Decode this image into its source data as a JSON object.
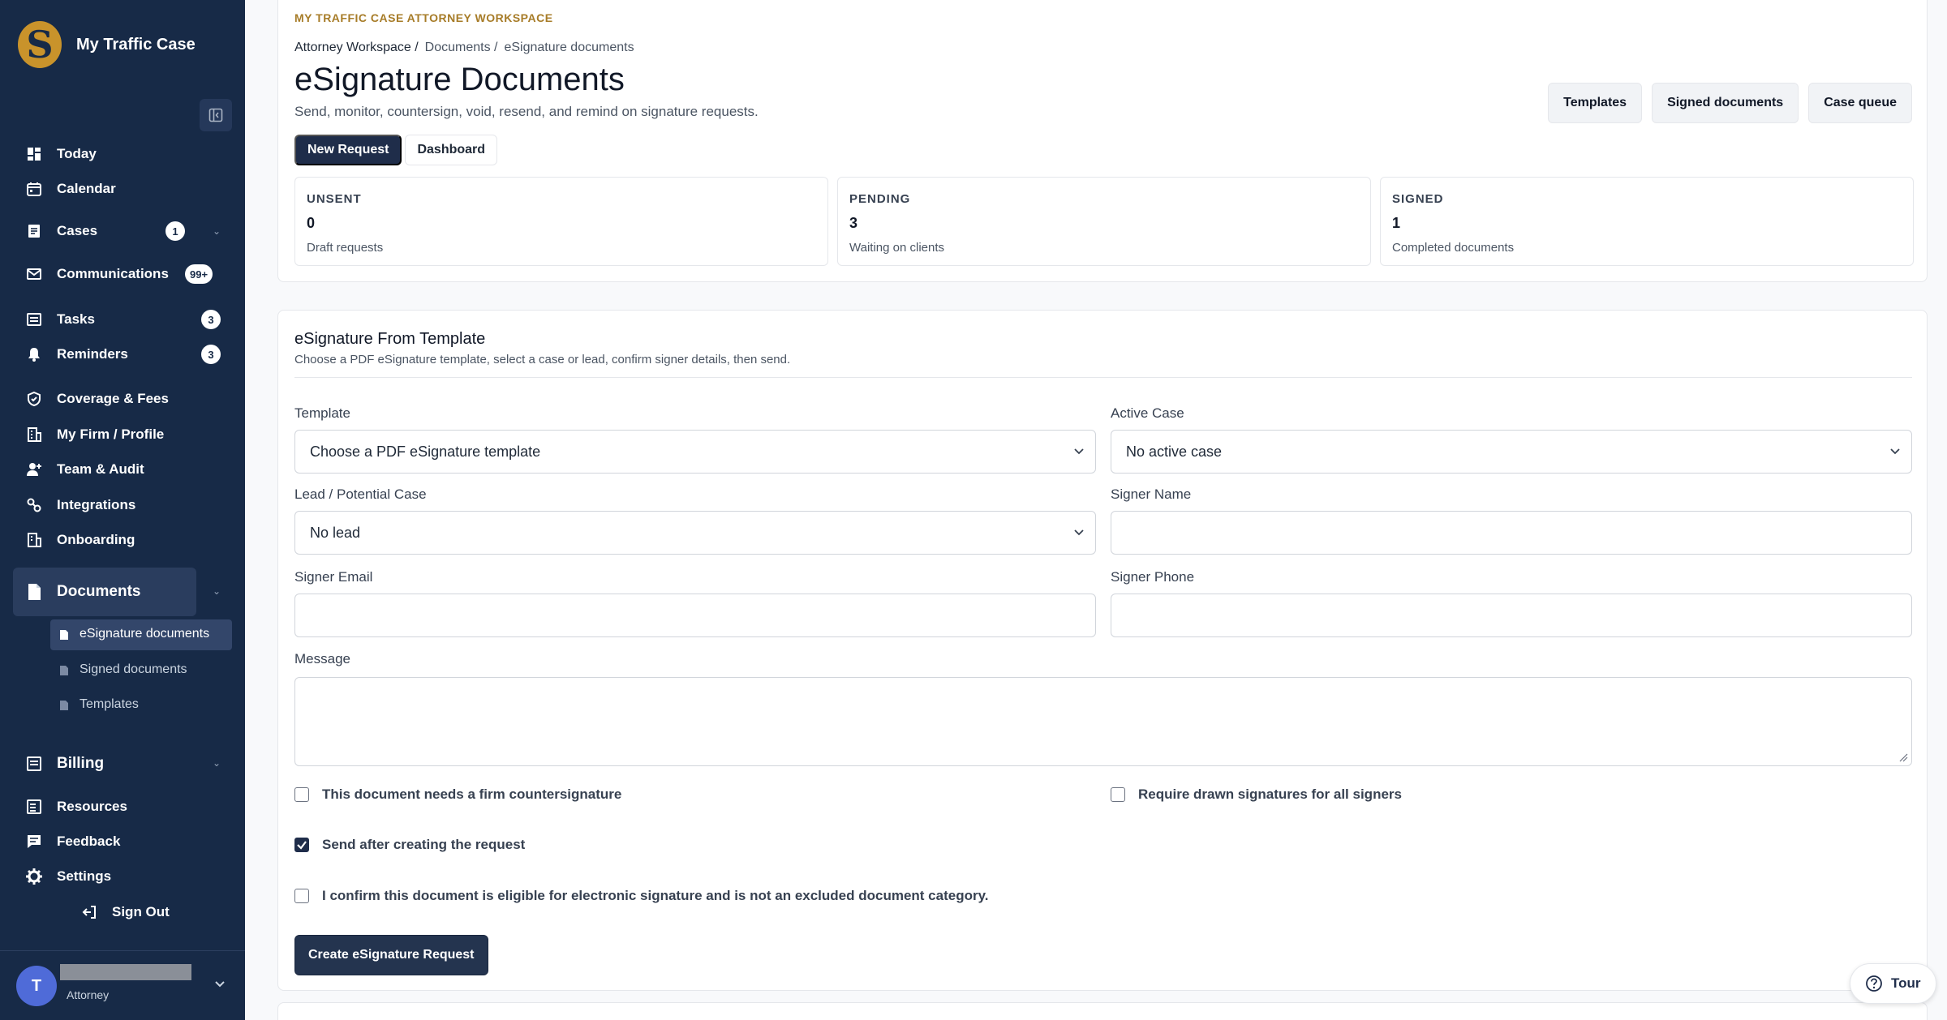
{
  "brand": {
    "name": "My Traffic Case",
    "logo_letter": "S"
  },
  "sidebar": {
    "items": [
      {
        "label": "Today",
        "icon": "dashboard-icon"
      },
      {
        "label": "Calendar",
        "icon": "calendar-icon"
      },
      {
        "label": "Cases",
        "icon": "cases-icon",
        "badge": "1"
      },
      {
        "label": "Communications",
        "icon": "mail-icon",
        "badge": "99+"
      },
      {
        "label": "Tasks",
        "icon": "tasks-icon",
        "badge": "3"
      },
      {
        "label": "Reminders",
        "icon": "bell-icon",
        "badge": "3"
      },
      {
        "label": "Coverage & Fees",
        "icon": "shield-icon"
      },
      {
        "label": "My Firm / Profile",
        "icon": "building-icon"
      },
      {
        "label": "Team & Audit",
        "icon": "user-plus-icon"
      },
      {
        "label": "Integrations",
        "icon": "link-icon"
      },
      {
        "label": "Onboarding",
        "icon": "building-icon"
      },
      {
        "label": "Documents",
        "icon": "document-icon"
      },
      {
        "label": "Billing",
        "icon": "billing-icon"
      },
      {
        "label": "Resources",
        "icon": "resources-icon"
      },
      {
        "label": "Feedback",
        "icon": "chat-icon"
      },
      {
        "label": "Settings",
        "icon": "gear-icon"
      }
    ],
    "sub_items": [
      {
        "label": "eSignature documents"
      },
      {
        "label": "Signed documents"
      },
      {
        "label": "Templates"
      }
    ],
    "sign_out": "Sign Out",
    "user": {
      "initial": "T",
      "role": "Attorney"
    }
  },
  "header": {
    "eyebrow": "MY TRAFFIC CASE ATTORNEY WORKSPACE",
    "breadcrumb": [
      "Attorney Workspace /",
      "Documents /",
      "eSignature documents"
    ],
    "title": "eSignature Documents",
    "subtitle": "Send, monitor, countersign, void, resend, and remind on signature requests.",
    "actions": [
      "Templates",
      "Signed documents",
      "Case queue"
    ],
    "tabs": [
      "New Request",
      "Dashboard"
    ]
  },
  "stats": [
    {
      "label": "UNSENT",
      "value": "0",
      "desc": "Draft requests"
    },
    {
      "label": "PENDING",
      "value": "3",
      "desc": "Waiting on clients"
    },
    {
      "label": "SIGNED",
      "value": "1",
      "desc": "Completed documents"
    }
  ],
  "form": {
    "title": "eSignature From Template",
    "subtitle": "Choose a PDF eSignature template, select a case or lead, confirm signer details, then send.",
    "template_label": "Template",
    "template_value": "Choose a PDF eSignature template",
    "active_case_label": "Active Case",
    "active_case_value": "No active case",
    "lead_label": "Lead / Potential Case",
    "lead_value": "No lead",
    "signer_name_label": "Signer Name",
    "signer_email_label": "Signer Email",
    "signer_phone_label": "Signer Phone",
    "message_label": "Message",
    "checks": {
      "countersign": "This document needs a firm countersignature",
      "drawn": "Require drawn signatures for all signers",
      "send_after": "Send after creating the request",
      "confirm": "I confirm this document is eligible for electronic signature and is not an excluded document category."
    },
    "submit": "Create eSignature Request"
  },
  "tour": "Tour"
}
